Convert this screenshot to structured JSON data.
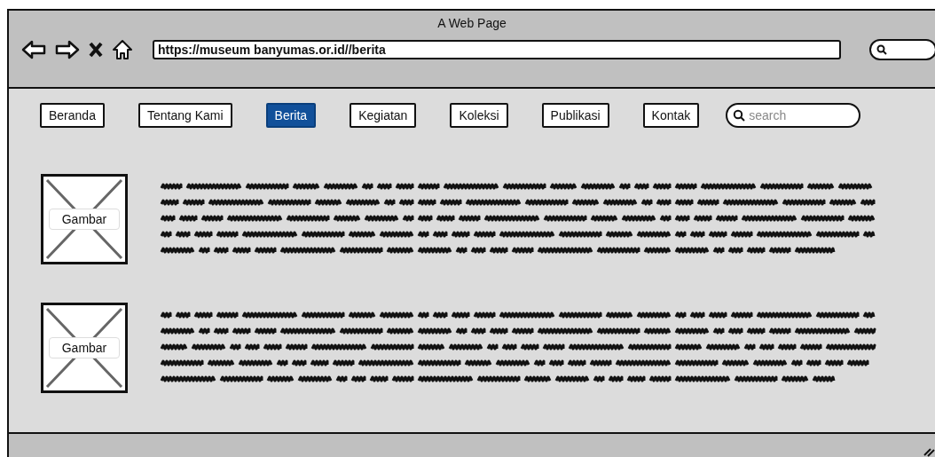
{
  "window": {
    "title": "A Web Page"
  },
  "address_bar": {
    "value": "https://museum banyumas.or.id//berita"
  },
  "nav": [
    {
      "label": "Beranda",
      "selected": false
    },
    {
      "label": "Tentang Kami",
      "selected": false
    },
    {
      "label": "Berita",
      "selected": true
    },
    {
      "label": "Kegiatan",
      "selected": false
    },
    {
      "label": "Koleksi",
      "selected": false
    },
    {
      "label": "Publikasi",
      "selected": false
    },
    {
      "label": "Kontak",
      "selected": false
    }
  ],
  "nav_search": {
    "placeholder": "search"
  },
  "articles": [
    {
      "image_label": "Gambar"
    },
    {
      "image_label": "Gambar"
    }
  ]
}
